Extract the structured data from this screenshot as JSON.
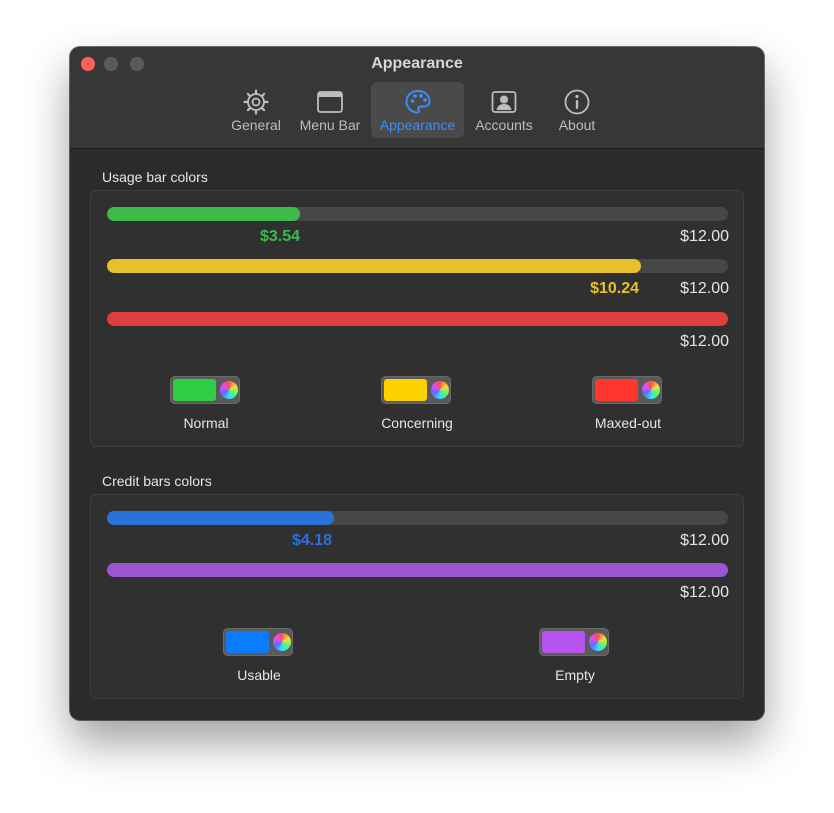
{
  "window": {
    "title": "Appearance"
  },
  "tabs": [
    {
      "label": "General",
      "icon": "gear-icon",
      "active": false
    },
    {
      "label": "Menu Bar",
      "icon": "menu-bar-icon",
      "active": false
    },
    {
      "label": "Appearance",
      "icon": "palette-icon",
      "active": true
    },
    {
      "label": "Accounts",
      "icon": "account-icon",
      "active": false
    },
    {
      "label": "About",
      "icon": "info-icon",
      "active": false
    }
  ],
  "usage_section": {
    "title": "Usage bar colors",
    "bars": [
      {
        "value": "$3.54",
        "max": "$12.00",
        "fraction": 0.31,
        "color": "#3cba4a"
      },
      {
        "value": "$10.24",
        "max": "$12.00",
        "fraction": 0.86,
        "color": "#e6c12c"
      },
      {
        "value": "",
        "max": "$12.00",
        "fraction": 1.0,
        "color": "#df3f3c"
      }
    ],
    "swatches": [
      {
        "label": "Normal",
        "color": "#2fcf45"
      },
      {
        "label": "Concerning",
        "color": "#fdd000"
      },
      {
        "label": "Maxed-out",
        "color": "#fe362e"
      }
    ]
  },
  "credit_section": {
    "title": "Credit bars colors",
    "bars": [
      {
        "value": "$4.18",
        "max": "$12.00",
        "fraction": 0.365,
        "color": "#2a72da"
      },
      {
        "value": "",
        "max": "$12.00",
        "fraction": 1.0,
        "color": "#9c54d0"
      }
    ],
    "swatches": [
      {
        "label": "Usable",
        "color": "#0a7cff"
      },
      {
        "label": "Empty",
        "color": "#b753ee"
      }
    ]
  }
}
